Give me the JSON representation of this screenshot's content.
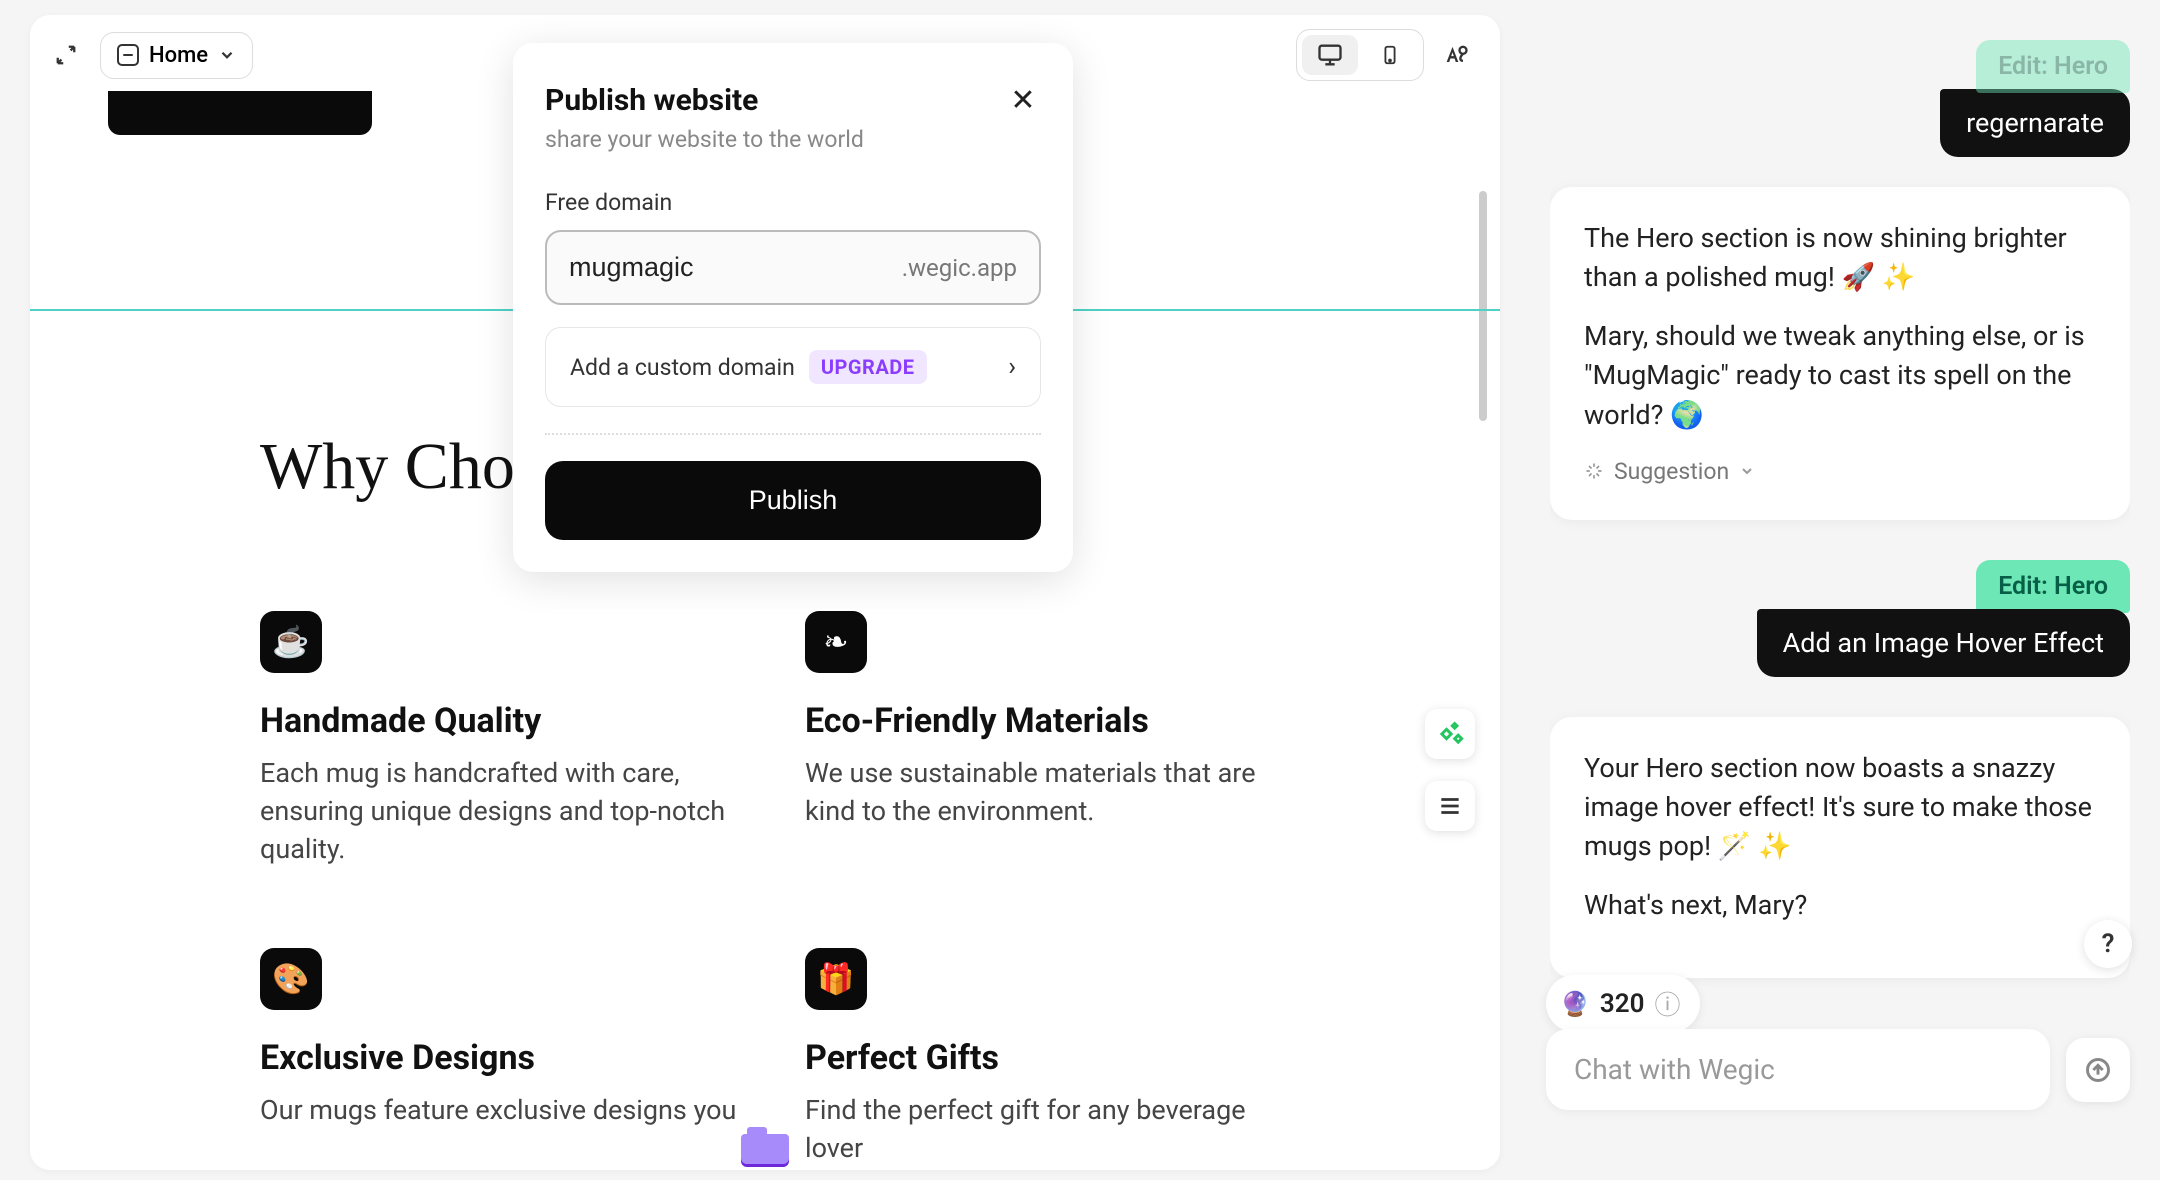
{
  "topbar": {
    "home_label": "Home"
  },
  "publish": {
    "title": "Publish website",
    "subtitle": "share your website to the world",
    "domain_label": "Free domain",
    "domain_value": "mugmagic",
    "domain_suffix": ".wegic.app",
    "custom_domain_label": "Add a custom domain",
    "upgrade_badge": "UPGRADE",
    "publish_button": "Publish"
  },
  "page": {
    "section_heading": "Why Choose",
    "features": [
      {
        "icon": "mug-icon",
        "glyph": "☕",
        "title": "Handmade Quality",
        "desc": "Each mug is handcrafted with care, ensuring unique designs and top-notch quality."
      },
      {
        "icon": "leaf-icon",
        "glyph": "❧",
        "title": "Eco-Friendly Materials",
        "desc": "We use sustainable materials that are kind to the environment."
      },
      {
        "icon": "palette-icon",
        "glyph": "🎨",
        "title": "Exclusive Designs",
        "desc": "Our mugs feature exclusive designs you"
      },
      {
        "icon": "gift-icon",
        "glyph": "🎁",
        "title": "Perfect Gifts",
        "desc": "Find the perfect gift for any beverage lover"
      }
    ]
  },
  "chat": {
    "top_chip": "Edit: Hero",
    "top_action": "regernarate",
    "assistant1_p1": "The Hero section is now shining brighter than a polished mug! 🚀 ✨",
    "assistant1_p2": "Mary, should we tweak anything else, or is \"MugMagic\" ready to cast its spell on the world? 🌍",
    "suggestion_label": "Suggestion",
    "user_chip": "Edit: Hero",
    "user_action": "Add an Image Hover Effect",
    "assistant2_p1": "Your Hero section now boasts a snazzy image hover effect! It's sure to make those mugs pop! 🪄 ✨",
    "assistant2_p2": "What's next, Mary?",
    "credits": "320",
    "input_placeholder": "Chat with Wegic",
    "help": "?"
  }
}
